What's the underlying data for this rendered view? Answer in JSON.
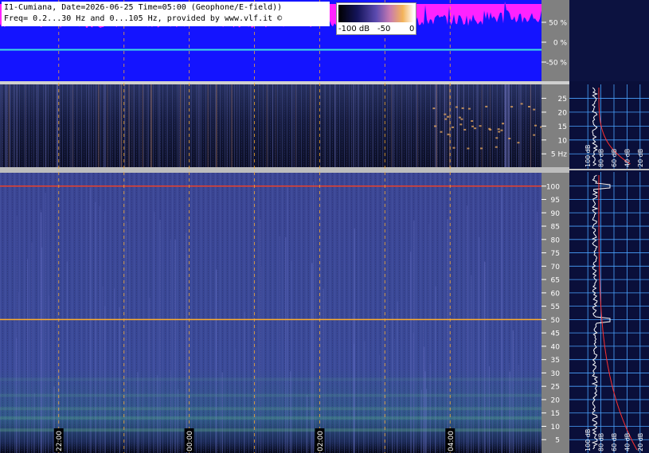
{
  "header": {
    "line1": "I1-Cumiana, Date=2026-06-25 Time=05:00 (Geophone/E-field))",
    "line2": "Freq= 0.2...30 Hz and 0...105 Hz, provided by www.vlf.it ©"
  },
  "colorbar": {
    "labels": [
      "-100 dB",
      "-50",
      "0"
    ]
  },
  "colors": {
    "amp_bg": "#1414ff",
    "amp_fill": "#ff22ff",
    "amp_trace": "#40e0e0",
    "spec_bg": "#3d4696",
    "panel_bg": "#0a0f3a",
    "axis_bg": "#808080",
    "grid": "#4aa3ff",
    "marker_line": "#ffae2a",
    "hum_line": "#e8402a",
    "spectrum_trace": "#ffffff",
    "noise_trace": "#ff3030"
  },
  "chart_data": [
    {
      "type": "line",
      "name": "amplitude",
      "y_ticks": [
        "50 %",
        "0 %",
        "-50 %"
      ],
      "y_values": [
        50,
        0,
        -50
      ],
      "ylim": [
        -100,
        100
      ]
    },
    {
      "type": "heatmap",
      "name": "ulf-spectrogram",
      "y_tick_labels": [
        "25",
        "20",
        "15",
        "10",
        "5 Hz"
      ],
      "y_values": [
        25,
        20,
        15,
        10,
        5
      ],
      "ylim": [
        0.2,
        30
      ]
    },
    {
      "type": "heatmap",
      "name": "elf-spectrogram",
      "y_tick_labels": [
        "100",
        "95",
        "90",
        "85",
        "80",
        "75",
        "70",
        "65",
        "60",
        "55",
        "50",
        "45",
        "40",
        "35",
        "30",
        "25",
        "20",
        "15",
        "10",
        "5"
      ],
      "y_values": [
        100,
        95,
        90,
        85,
        80,
        75,
        70,
        65,
        60,
        55,
        50,
        45,
        40,
        35,
        30,
        25,
        20,
        15,
        10,
        5
      ],
      "ylim": [
        0,
        105
      ],
      "time_labels": [
        "22:00",
        "00:00",
        "02:00",
        "04:00"
      ],
      "time_label_hours": [
        22,
        24,
        26,
        28
      ],
      "time_range_hours": [
        21.1,
        29.4
      ],
      "markers_hz": [
        100,
        50
      ]
    },
    {
      "type": "line",
      "name": "ulf-average-spectrum",
      "x_tick_labels": [
        "100 dB",
        "80 dB",
        "60 dB",
        "40 dB",
        "20 dB"
      ],
      "x_values_db": [
        100,
        80,
        60,
        40,
        20
      ],
      "xlim": [
        110,
        10
      ]
    },
    {
      "type": "line",
      "name": "elf-average-spectrum",
      "x_tick_labels": [
        "100 dB",
        "80 dB",
        "60 dB",
        "40 dB",
        "20 dB"
      ],
      "x_values_db": [
        100,
        80,
        60,
        40,
        20
      ],
      "xlim": [
        110,
        10
      ]
    }
  ]
}
